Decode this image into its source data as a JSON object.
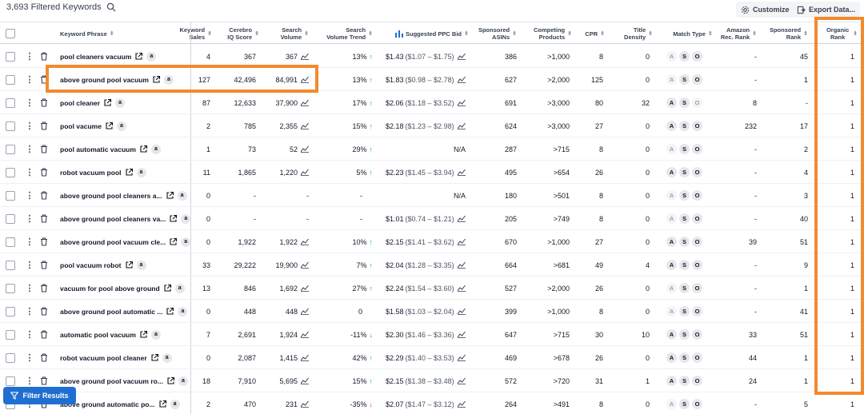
{
  "toolbar": {
    "filtered_count": "3,693 Filtered Keywords",
    "customize_label": "Customize",
    "export_label": "Export Data..."
  },
  "columns": {
    "keyword": "Keyword Phrase",
    "word_sales": "Keyword Sales",
    "cerebro": "Cerebro IQ Score",
    "search_volume": "Search Volume",
    "sv_trend": "Search Volume Trend",
    "ppc": "Suggested PPC Bid",
    "sponsored_asins": "Sponsored ASINs",
    "competing": "Competing Products",
    "cpr": "CPR",
    "title_density": "Title Density",
    "match_type": "Match Type",
    "amazon_rank": "Amazon Rec. Rank",
    "sponsored_rank": "Sponsored Rank",
    "organic_rank": "Organic Rank"
  },
  "rows": [
    {
      "kw": "pool cleaners vacuum",
      "sales": "4",
      "iq": "367",
      "sv": "367",
      "trend": "13%",
      "dir": "up",
      "ppc": "$1.43",
      "ppc_range": "($1.07 – $1.75)",
      "sasins": "386",
      "comp": ">1,000",
      "cpr": "8",
      "td": "0",
      "mt": [
        "off",
        "on",
        "on"
      ],
      "arank": "-",
      "srank": "45",
      "orank": "1"
    },
    {
      "kw": "above ground pool vacuum",
      "sales": "127",
      "iq": "42,496",
      "sv": "84,991",
      "trend": "13%",
      "dir": "up",
      "ppc": "$1.83",
      "ppc_range": "($0.98 – $2.78)",
      "sasins": "627",
      "comp": ">2,000",
      "cpr": "125",
      "td": "0",
      "mt": [
        "off",
        "on",
        "on"
      ],
      "arank": "-",
      "srank": "1",
      "orank": "1"
    },
    {
      "kw": "pool cleaner",
      "sales": "87",
      "iq": "12,633",
      "sv": "37,900",
      "trend": "17%",
      "dir": "up",
      "ppc": "$2.06",
      "ppc_range": "($1.18 – $3.52)",
      "sasins": "691",
      "comp": ">3,000",
      "cpr": "80",
      "td": "32",
      "mt": [
        "on",
        "on",
        "off"
      ],
      "arank": "8",
      "srank": "-",
      "orank": "1"
    },
    {
      "kw": "pool vacume",
      "sales": "2",
      "iq": "785",
      "sv": "2,355",
      "trend": "15%",
      "dir": "up",
      "ppc": "$2.18",
      "ppc_range": "($1.23 – $2.98)",
      "sasins": "624",
      "comp": ">3,000",
      "cpr": "27",
      "td": "0",
      "mt": [
        "on",
        "on",
        "on"
      ],
      "arank": "232",
      "srank": "17",
      "orank": "1"
    },
    {
      "kw": "pool automatic vacuum",
      "sales": "1",
      "iq": "73",
      "sv": "52",
      "trend": "29%",
      "dir": "up",
      "ppc": "N/A",
      "ppc_range": "",
      "sasins": "287",
      "comp": ">715",
      "cpr": "8",
      "td": "0",
      "mt": [
        "off",
        "on",
        "on"
      ],
      "arank": "-",
      "srank": "2",
      "orank": "1"
    },
    {
      "kw": "robot vacuum pool",
      "sales": "11",
      "iq": "1,865",
      "sv": "1,220",
      "trend": "5%",
      "dir": "up",
      "ppc": "$2.23",
      "ppc_range": "($1.45 – $3.94)",
      "sasins": "495",
      "comp": ">654",
      "cpr": "26",
      "td": "0",
      "mt": [
        "on",
        "on",
        "on"
      ],
      "arank": "-",
      "srank": "4",
      "orank": "1"
    },
    {
      "kw": "above ground pool cleaners a...",
      "sales": "0",
      "iq": "-",
      "sv": "-",
      "trend": "-",
      "dir": "",
      "ppc": "N/A",
      "ppc_range": "",
      "sasins": "180",
      "comp": ">501",
      "cpr": "8",
      "td": "0",
      "mt": [
        "off",
        "on",
        "on"
      ],
      "arank": "-",
      "srank": "3",
      "orank": "1"
    },
    {
      "kw": "above ground pool cleaners va...",
      "sales": "0",
      "iq": "-",
      "sv": "-",
      "trend": "-",
      "dir": "",
      "ppc": "$1.01",
      "ppc_range": "($0.74 – $1.21)",
      "sasins": "205",
      "comp": ">749",
      "cpr": "8",
      "td": "0",
      "mt": [
        "off",
        "on",
        "on"
      ],
      "arank": "-",
      "srank": "40",
      "orank": "1"
    },
    {
      "kw": "above ground pool vacuum cle...",
      "sales": "0",
      "iq": "1,922",
      "sv": "1,922",
      "trend": "10%",
      "dir": "up",
      "ppc": "$2.15",
      "ppc_range": "($1.41 – $3.62)",
      "sasins": "670",
      "comp": ">1,000",
      "cpr": "27",
      "td": "0",
      "mt": [
        "on",
        "on",
        "on"
      ],
      "arank": "39",
      "srank": "51",
      "orank": "1"
    },
    {
      "kw": "pool vacuum robot",
      "sales": "33",
      "iq": "29,222",
      "sv": "19,900",
      "trend": "7%",
      "dir": "up",
      "ppc": "$2.04",
      "ppc_range": "($1.28 – $3.35)",
      "sasins": "664",
      "comp": ">681",
      "cpr": "49",
      "td": "4",
      "mt": [
        "on",
        "on",
        "on"
      ],
      "arank": "-",
      "srank": "9",
      "orank": "1"
    },
    {
      "kw": "vacuum for pool above ground",
      "sales": "13",
      "iq": "846",
      "sv": "1,692",
      "trend": "27%",
      "dir": "up",
      "ppc": "$2.24",
      "ppc_range": "($1.54 – $3.60)",
      "sasins": "527",
      "comp": ">2,000",
      "cpr": "26",
      "td": "0",
      "mt": [
        "off",
        "on",
        "on"
      ],
      "arank": "-",
      "srank": "1",
      "orank": "1"
    },
    {
      "kw": "above ground pool automatic ...",
      "sales": "0",
      "iq": "448",
      "sv": "448",
      "trend": "0",
      "dir": "",
      "ppc": "$1.58",
      "ppc_range": "($1.03 – $2.04)",
      "sasins": "399",
      "comp": ">1,000",
      "cpr": "8",
      "td": "0",
      "mt": [
        "off",
        "on",
        "on"
      ],
      "arank": "-",
      "srank": "41",
      "orank": "1"
    },
    {
      "kw": "automatic pool vacuum",
      "sales": "7",
      "iq": "2,691",
      "sv": "1,924",
      "trend": "-11%",
      "dir": "down",
      "ppc": "$2.30",
      "ppc_range": "($1.46 – $3.36)",
      "sasins": "647",
      "comp": ">715",
      "cpr": "30",
      "td": "10",
      "mt": [
        "on",
        "on",
        "on"
      ],
      "arank": "33",
      "srank": "51",
      "orank": "1"
    },
    {
      "kw": "robot vacuum pool cleaner",
      "sales": "0",
      "iq": "2,087",
      "sv": "1,415",
      "trend": "42%",
      "dir": "up",
      "ppc": "$2.29",
      "ppc_range": "($1.40 – $3.53)",
      "sasins": "469",
      "comp": ">678",
      "cpr": "26",
      "td": "0",
      "mt": [
        "on",
        "on",
        "on"
      ],
      "arank": "44",
      "srank": "1",
      "orank": "1"
    },
    {
      "kw": "above ground pool vacuum ro...",
      "sales": "18",
      "iq": "7,910",
      "sv": "5,695",
      "trend": "15%",
      "dir": "up",
      "ppc": "$2.15",
      "ppc_range": "($1.38 – $3.48)",
      "sasins": "572",
      "comp": ">720",
      "cpr": "31",
      "td": "1",
      "mt": [
        "on",
        "on",
        "on"
      ],
      "arank": "24",
      "srank": "1",
      "orank": "1"
    },
    {
      "kw": "above ground automatic po...",
      "sales": "2",
      "iq": "470",
      "sv": "231",
      "trend": "-35%",
      "dir": "down",
      "ppc": "$2.07",
      "ppc_range": "($1.47 – $3.12)",
      "sasins": "264",
      "comp": ">491",
      "cpr": "8",
      "td": "0",
      "mt": [
        "off",
        "on",
        "on"
      ],
      "arank": "-",
      "srank": "5",
      "orank": "1"
    }
  ],
  "filter_button": "Filter Results",
  "colors": {
    "highlight": "#f28a2e",
    "primary": "#1f6fd1",
    "trend_up": "#10b981",
    "trend_down": "#ef4444"
  }
}
